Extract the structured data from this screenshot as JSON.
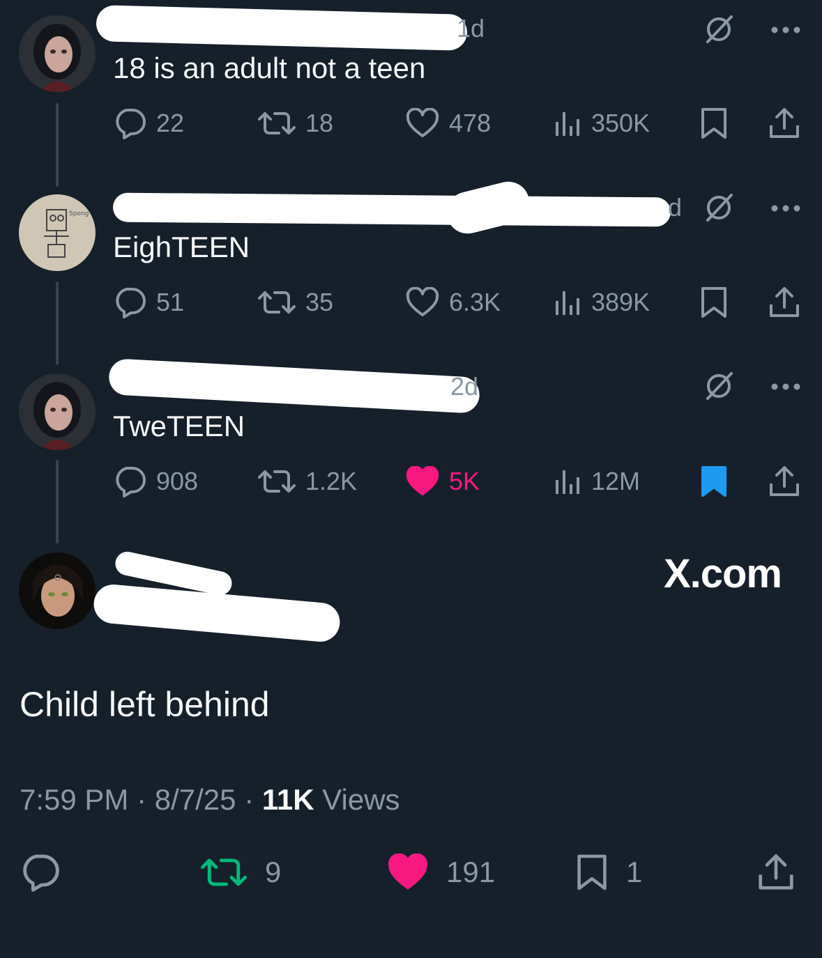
{
  "tweets": [
    {
      "time_fragment": "1d",
      "text": "18 is an adult not a teen",
      "replies": "22",
      "retweets": "18",
      "likes": "478",
      "views": "350K",
      "liked": false,
      "bookmarked": false
    },
    {
      "time_fragment": "d",
      "text": "EighTEEN",
      "replies": "51",
      "retweets": "35",
      "likes": "6.3K",
      "views": "389K",
      "liked": false,
      "bookmarked": false
    },
    {
      "time_fragment": "2d",
      "text": "TweTEEN",
      "replies": "908",
      "retweets": "1.2K",
      "likes": "5K",
      "views": "12M",
      "liked": true,
      "bookmarked": true
    }
  ],
  "main_post": {
    "text": "Child left behind",
    "time": "7:59 PM",
    "date": "8/7/25",
    "views_count": "11K",
    "views_label": "Views",
    "retweets": "9",
    "likes": "191",
    "bookmarks": "1"
  },
  "watermark": "X.com",
  "colors": {
    "background": "#15202b",
    "muted": "#8b98a5",
    "like_pink": "#f91880",
    "retweet_green": "#00ba7c",
    "bookmark_blue": "#1d9bf0"
  }
}
